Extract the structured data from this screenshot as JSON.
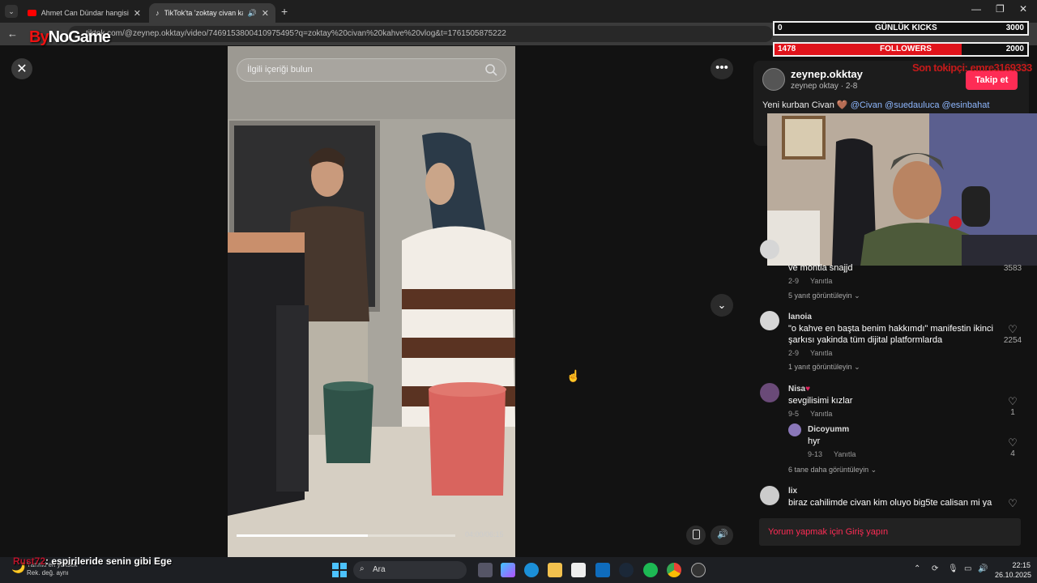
{
  "tabs": [
    {
      "title": "Ahmet Can Dündar hangisi gerç"
    },
    {
      "title": "TikTok'ta 'zoktay civan kahve"
    }
  ],
  "omnibox_url": "tiktok.com/@zeynep.okktay/video/7469153800410975495?q=zoktay%20civan%20kahve%20vlog&t=1761505875222",
  "overlay": {
    "brand_by": "By",
    "brand_rest": "NoGame",
    "kicks_label": "GÜNLÜK KICKS",
    "kicks_current": "0",
    "kicks_goal": "3000",
    "kicks_progress": 0,
    "followers_label": "FOLLOWERS",
    "followers_current": "1478",
    "followers_goal": "2000",
    "followers_progress": 0.74,
    "last_tip": "Son tokipçi: emre3169333"
  },
  "video": {
    "search_placeholder": "İlgili içeriği bulun",
    "timecode": "04:00/06:15",
    "progress": 0.6
  },
  "post": {
    "username": "zeynep.okktay",
    "subname": "zeynep oktay · 2-8",
    "follow": "Takip et",
    "caption_text": "Yeni kurban Civan 🤎 ",
    "caption_tags": "@Civan @suedauluca @esinbahat"
  },
  "comments": [
    {
      "name": "",
      "text": "ve montla snajjd",
      "meta": "2-9",
      "reply": "Yanıtla",
      "likes": "3583",
      "more": "5 yanıt görüntüleyin"
    },
    {
      "name": "lanoia",
      "text": "\"o kahve en başta benim hakkımdı\" manifestin ikinci şarkısı yakinda tüm dijital platformlarda",
      "meta": "2-9",
      "reply": "Yanıtla",
      "likes": "2254",
      "more": "1 yanıt görüntüleyin"
    },
    {
      "name": "Nisa",
      "text": "sevgilisimi kızlar",
      "meta": "9-5",
      "reply": "Yanıtla",
      "likes": "1",
      "more": ""
    },
    {
      "name": "Dicoyumm",
      "text": "hyr",
      "meta": "9-13",
      "reply": "Yanıtla",
      "likes": "4",
      "more": "6 tane daha görüntüleyin"
    },
    {
      "name": "lix",
      "text": "biraz cahilimde civan kim oluyo big5te calisan mi ya",
      "meta": "",
      "reply": "",
      "likes": "",
      "more": ""
    }
  ],
  "login_prompt": "Yorum yapmak için Giriş yapın",
  "chat": {
    "user": "Rust72",
    "message": ": espirileride senin gibi Ege"
  },
  "taskbar": {
    "weather_line1": "Yarınki en yüksek",
    "weather_line2": "Rek. değ. aynı",
    "search_label": "Ara",
    "time": "22:15",
    "date": "26.10.2025"
  }
}
